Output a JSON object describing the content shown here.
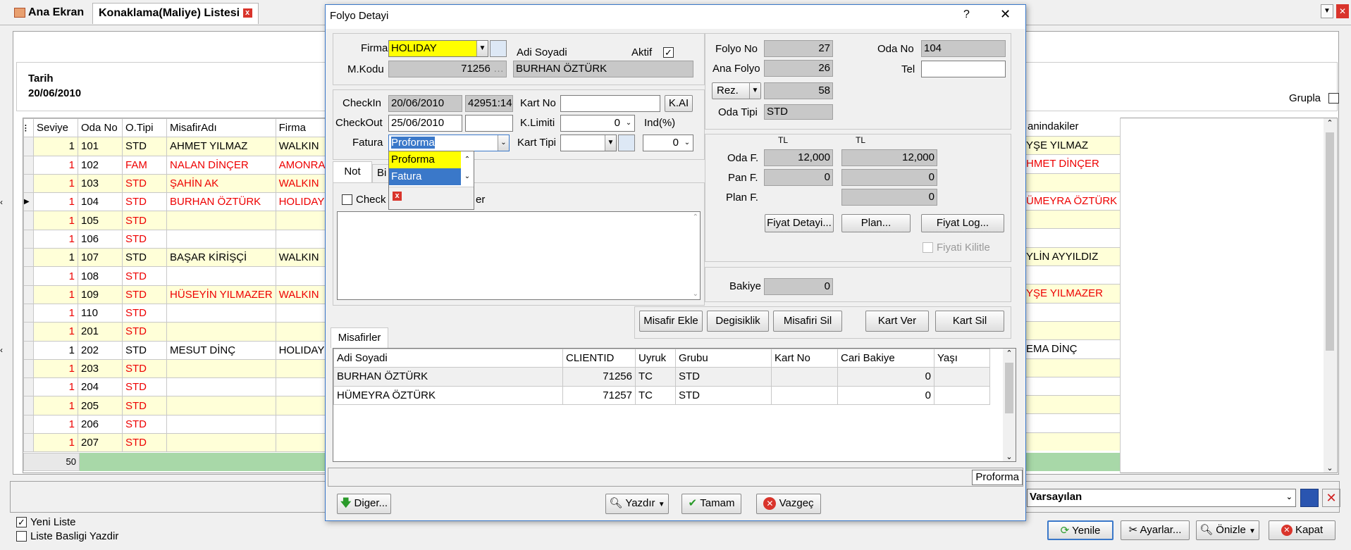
{
  "tabs": [
    {
      "label": "Ana Ekran"
    },
    {
      "label": "Konaklama(Maliye) Listesi"
    }
  ],
  "header": {
    "date_label": "Tarih",
    "date_value": "20/06/2010",
    "group_label": "Grupla"
  },
  "grid": {
    "columns": [
      "Seviye",
      "Oda No",
      "O.Tipi",
      "MisafirAdı",
      "Firma",
      "anindakiler"
    ],
    "rows": [
      {
        "seviye": "1",
        "oda": "101",
        "tip": "STD",
        "ad": "AHMET YILMAZ",
        "firma": "WALKIN",
        "yan": "YŞE YILMAZ",
        "red": false,
        "y": true
      },
      {
        "seviye": "1",
        "oda": "102",
        "tip": "FAM",
        "ad": "NALAN DİNÇER",
        "firma": "AMONRA",
        "yan": "HMET DİNÇER",
        "red": true,
        "y": false
      },
      {
        "seviye": "1",
        "oda": "103",
        "tip": "STD",
        "ad": "ŞAHİN AK",
        "firma": "WALKIN",
        "yan": "",
        "red": true,
        "y": true
      },
      {
        "seviye": "1",
        "oda": "104",
        "tip": "STD",
        "ad": "BURHAN ÖZTÜRK",
        "firma": "HOLIDAY",
        "yan": "ÜMEYRA ÖZTÜRK",
        "red": true,
        "y": false
      },
      {
        "seviye": "1",
        "oda": "105",
        "tip": "STD",
        "ad": "",
        "firma": "",
        "yan": "",
        "red": true,
        "y": true
      },
      {
        "seviye": "1",
        "oda": "106",
        "tip": "STD",
        "ad": "",
        "firma": "",
        "yan": "",
        "red": true,
        "y": false
      },
      {
        "seviye": "1",
        "oda": "107",
        "tip": "STD",
        "ad": "BAŞAR KİRİŞÇİ",
        "firma": "WALKIN",
        "yan": "YLİN AYYILDIZ",
        "red": false,
        "y": true
      },
      {
        "seviye": "1",
        "oda": "108",
        "tip": "STD",
        "ad": "",
        "firma": "",
        "yan": "",
        "red": true,
        "y": false
      },
      {
        "seviye": "1",
        "oda": "109",
        "tip": "STD",
        "ad": "HÜSEYİN YILMAZER",
        "firma": "WALKIN",
        "yan": "YŞE YILMAZER",
        "red": true,
        "y": true
      },
      {
        "seviye": "1",
        "oda": "110",
        "tip": "STD",
        "ad": "",
        "firma": "",
        "yan": "",
        "red": true,
        "y": false
      },
      {
        "seviye": "1",
        "oda": "201",
        "tip": "STD",
        "ad": "",
        "firma": "",
        "yan": "",
        "red": true,
        "y": true
      },
      {
        "seviye": "1",
        "oda": "202",
        "tip": "STD",
        "ad": "MESUT DİNÇ",
        "firma": "HOLIDAY",
        "yan": "EMA DİNÇ",
        "red": false,
        "y": false
      },
      {
        "seviye": "1",
        "oda": "203",
        "tip": "STD",
        "ad": "",
        "firma": "",
        "yan": "",
        "red": true,
        "y": true
      },
      {
        "seviye": "1",
        "oda": "204",
        "tip": "STD",
        "ad": "",
        "firma": "",
        "yan": "",
        "red": true,
        "y": false
      },
      {
        "seviye": "1",
        "oda": "205",
        "tip": "STD",
        "ad": "",
        "firma": "",
        "yan": "",
        "red": true,
        "y": true
      },
      {
        "seviye": "1",
        "oda": "206",
        "tip": "STD",
        "ad": "",
        "firma": "",
        "yan": "",
        "red": true,
        "y": false
      },
      {
        "seviye": "1",
        "oda": "207",
        "tip": "STD",
        "ad": "",
        "firma": "",
        "yan": "",
        "red": true,
        "y": true
      }
    ],
    "footer_count": "50"
  },
  "bottom": {
    "layout_select": "Varsayılan",
    "yeni_liste": "Yeni Liste",
    "liste_basligi": "Liste Basligi Yazdir",
    "yenile": "Yenile",
    "ayarlar": "Ayarlar...",
    "onizle": "Önizle",
    "kapat": "Kapat"
  },
  "dialog": {
    "title": "Folyo Detayi",
    "help": "?",
    "close": "✕",
    "firma_label": "Firma",
    "firma_value": "HOLIDAY",
    "adisoyadi_label": "Adi Soyadi",
    "aktif_label": "Aktif",
    "mkodu_label": "M.Kodu",
    "mkodu_value": "71256",
    "name_value": "BURHAN ÖZTÜRK",
    "checkin_label": "CheckIn",
    "checkin_value": "20/06/2010",
    "checkin_extra": "42951:14",
    "checkout_label": "CheckOut",
    "checkout_value": "25/06/2010",
    "fatura_label": "Fatura",
    "fatura_value": "Proforma",
    "fatura_options": [
      "Proforma",
      "Fatura"
    ],
    "kartno_label": "Kart No",
    "kai_button": "K.AI",
    "klimiti_label": "K.Limiti",
    "klimiti_value": "0",
    "ind_label": "Ind(%)",
    "karttipi_label": "Kart Tipi",
    "karttipi_value": "0",
    "tab_not": "Not",
    "tab_bi": "Bi",
    "check_label": "Check",
    "check_suffix": "er",
    "folyono_label": "Folyo No",
    "folyono_value": "27",
    "anafolyo_label": "Ana Folyo",
    "anafolyo_value": "26",
    "rez_label": "Rez.",
    "rez_value": "58",
    "odatipi_label": "Oda Tipi",
    "odatipi_value": "STD",
    "odano_label": "Oda No",
    "odano_value": "104",
    "tel_label": "Tel",
    "tl1": "TL",
    "tl2": "TL",
    "odaf_label": "Oda F.",
    "odaf_1": "12,000",
    "odaf_2": "12,000",
    "panf_label": "Pan F.",
    "panf_1": "0",
    "panf_2": "0",
    "planf_label": "Plan F.",
    "planf_2": "0",
    "fiyat_detayi": "Fiyat Detayi...",
    "plan": "Plan...",
    "fiyat_log": "Fiyat Log...",
    "fiyati_kilitle": "Fiyati Kilitle",
    "bakiye_label": "Bakiye",
    "bakiye_value": "0",
    "misafir_ekle": "Misafir Ekle",
    "degisiklik": "Degisiklik",
    "misafiri_sil": "Misafiri Sil",
    "kart_ver": "Kart Ver",
    "kart_sil": "Kart Sil",
    "misafirler_tab": "Misafirler",
    "guest_columns": [
      "Adi Soyadi",
      "CLIENTID",
      "Uyruk",
      "Grubu",
      "Kart No",
      "Cari Bakiye",
      "Yaşı"
    ],
    "guests": [
      {
        "name": "BURHAN ÖZTÜRK",
        "id": "71256",
        "uyruk": "TC",
        "grubu": "STD",
        "kart": "",
        "bakiye": "0",
        "yas": ""
      },
      {
        "name": "HÜMEYRA ÖZTÜRK",
        "id": "71257",
        "uyruk": "TC",
        "grubu": "STD",
        "kart": "",
        "bakiye": "0",
        "yas": ""
      }
    ],
    "status_right": "Proforma",
    "diger": "Diger...",
    "yazdir": "Yazdır",
    "tamam": "Tamam",
    "vazgec": "Vazgeç"
  }
}
